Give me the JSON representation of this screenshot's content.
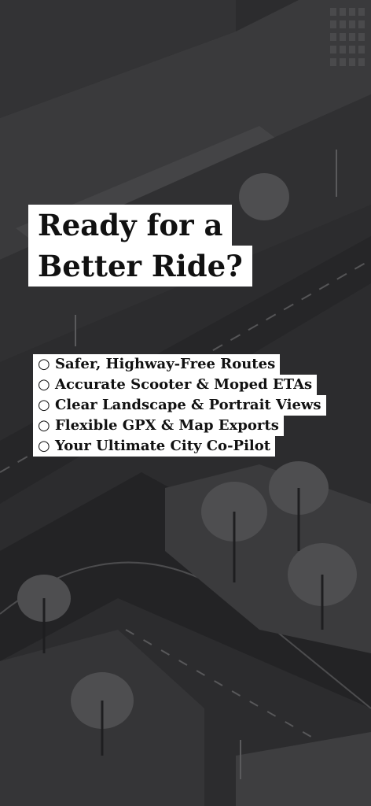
{
  "headline": {
    "line1": "Ready for a",
    "line2": "Better Ride?"
  },
  "features": [
    "○ Safer, Highway-Free Routes",
    "○ Accurate Scooter & Moped ETAs",
    "○ Clear Landscape & Portrait Views",
    "○ Flexible GPX & Map Exports",
    "○ Your Ultimate City Co-Pilot"
  ],
  "background": {
    "description_icon": "city-street-illustration",
    "color": "#2b2b2d"
  }
}
